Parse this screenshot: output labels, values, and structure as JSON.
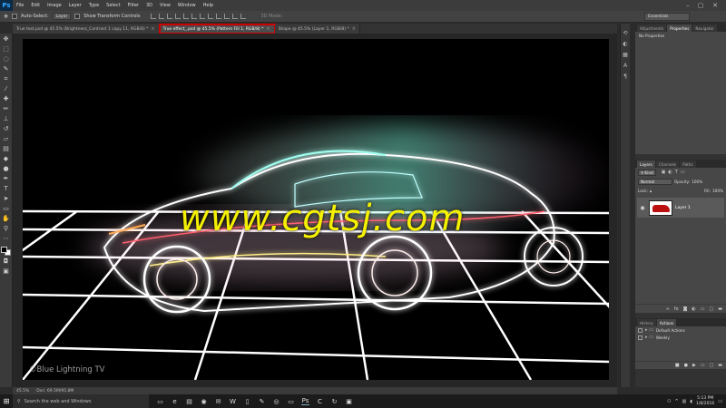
{
  "app": {
    "logo": "Ps"
  },
  "menubar": {
    "items": [
      "File",
      "Edit",
      "Image",
      "Layer",
      "Type",
      "Select",
      "Filter",
      "3D",
      "View",
      "Window",
      "Help"
    ]
  },
  "window_controls": [
    "–",
    "▢",
    "✕"
  ],
  "options": {
    "auto_select_label": "Auto-Select:",
    "auto_select_value": "Layer",
    "transform_label": "Show Transform Controls",
    "mode_3d_label": "3D Mode:",
    "workspace": "Essentials"
  },
  "tabs": [
    {
      "label": "True test.psd @ 45.5% (Brightness_Contrast 1 copy 11, RGB/8) *",
      "active": false
    },
    {
      "label": "True effect_.psd @ 45.5% (Pattern Fill 1, RGB/8) *",
      "active": true
    },
    {
      "label": "Shape @ 45.5% (Layer 1, RGB/8) *",
      "active": false
    }
  ],
  "canvas": {
    "watermark": "www.cgtsj.com",
    "channel_tag": "©Blue Lightning TV"
  },
  "status": {
    "zoom": "45.5%",
    "doc": "Doc: 69.5M/95.8M"
  },
  "panels": {
    "top_tabs": [
      "Adjustments",
      "Properties",
      "Navigator"
    ],
    "properties_title": "No Properties",
    "layer_tabs": [
      "Layers",
      "Channels",
      "Paths"
    ],
    "kind_label": "Kind",
    "blend_mode": "Normal",
    "opacity_label": "Opacity:",
    "opacity_value": "100%",
    "lock_label": "Lock:",
    "fill_label": "Fill:",
    "fill_value": "100%",
    "layer_name": "Layer 1",
    "history_tabs": [
      "History",
      "Actions"
    ],
    "actions": [
      "Default Actions",
      "Weekly"
    ]
  },
  "taskbar": {
    "search_placeholder": "Search the web and Windows",
    "time": "5:13 PM",
    "date": "1/8/2016"
  },
  "colors": {
    "tab_highlight": "#d10000",
    "watermark": "#f5f000",
    "ps_blue": "#31a8ff"
  }
}
